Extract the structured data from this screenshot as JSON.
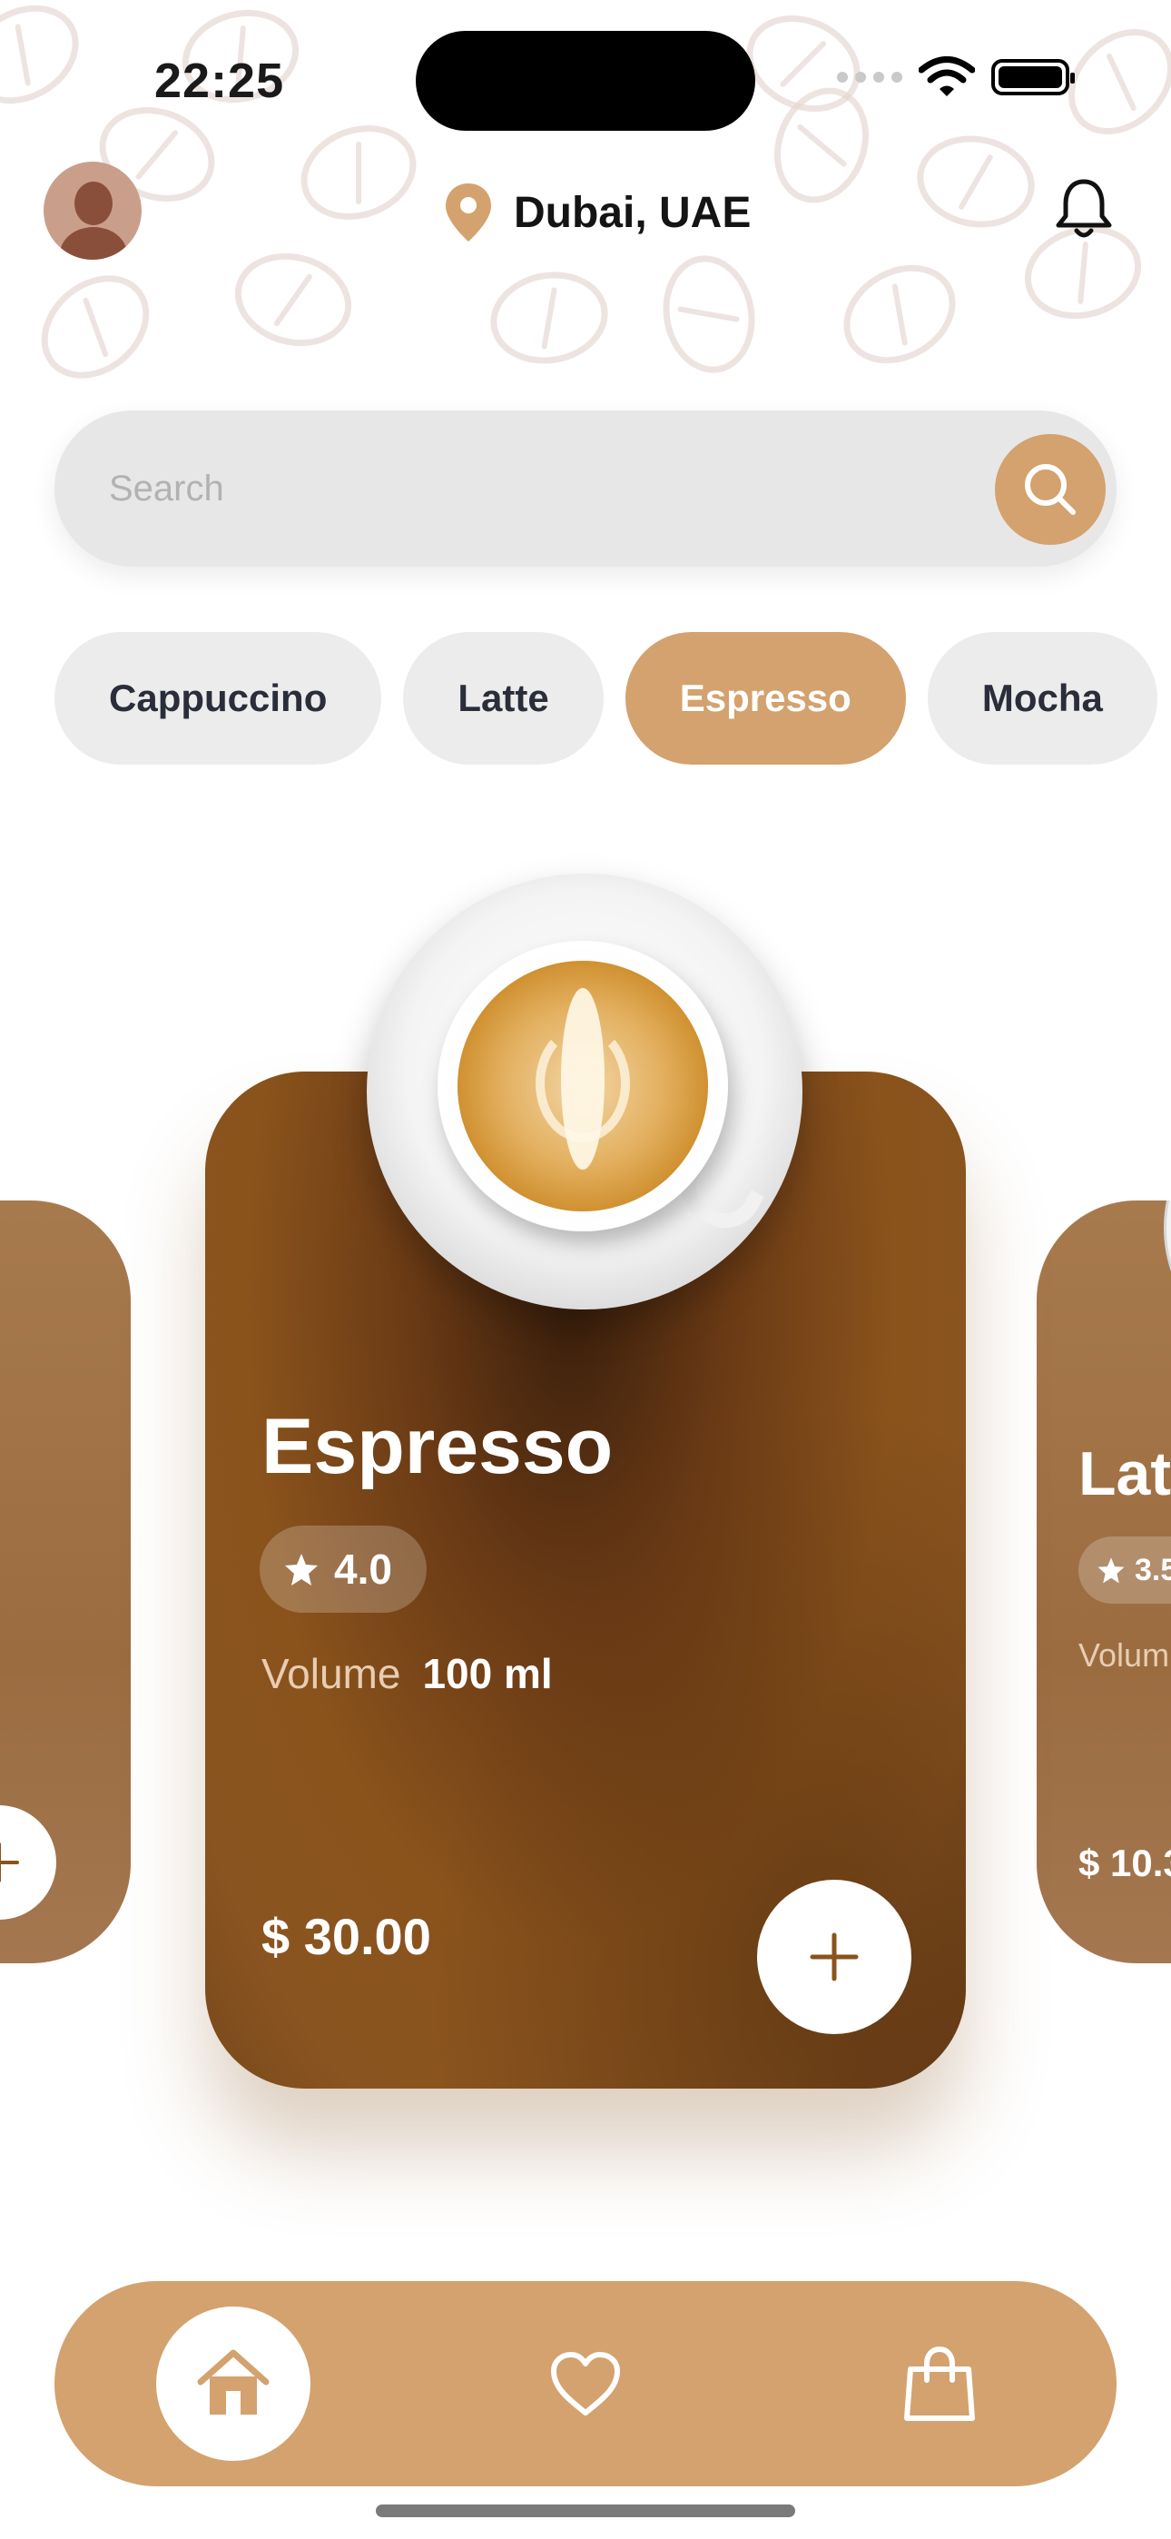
{
  "status_bar": {
    "time": "22:25"
  },
  "header": {
    "location": "Dubai, UAE"
  },
  "search": {
    "placeholder": "Search"
  },
  "categories": [
    {
      "label": "Cappuccino",
      "active": false
    },
    {
      "label": "Latte",
      "active": false
    },
    {
      "label": "Espresso",
      "active": true
    },
    {
      "label": "Mocha",
      "active": false
    }
  ],
  "featured": {
    "name": "Espresso",
    "rating": "4.0",
    "volume_label": "Volume",
    "volume_value": "100 ml",
    "price": "$ 30.00"
  },
  "next_card": {
    "name": "Latt",
    "rating": "3.5",
    "volume_label": "Volum",
    "price": "$ 10.3"
  },
  "colors": {
    "accent": "#d3a26e",
    "card": "#8a531c",
    "side_card": "#a67a4e"
  },
  "icons": {
    "location": "location-pin-icon",
    "notifications": "bell-icon",
    "search": "search-icon",
    "rating": "star-icon",
    "add": "plus-icon",
    "home": "home-icon",
    "favorites": "heart-icon",
    "cart": "shopping-bag-icon"
  }
}
